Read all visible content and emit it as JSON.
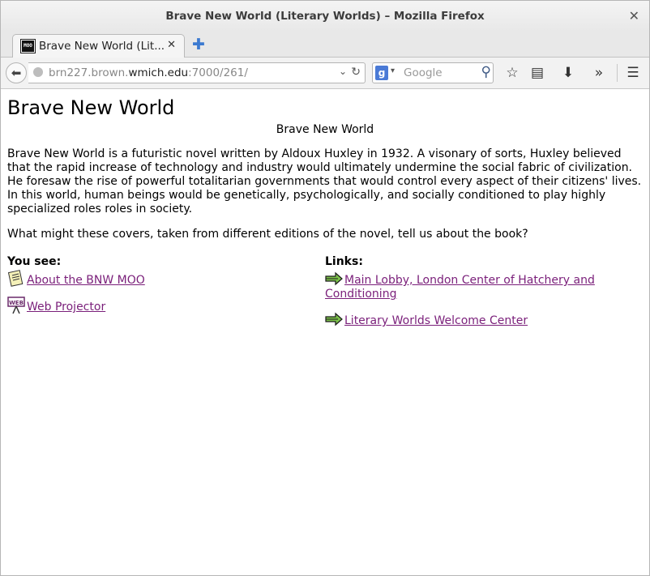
{
  "window": {
    "title": "Brave New World (Literary Worlds) – Mozilla Firefox"
  },
  "tab": {
    "label": "Brave New World (Lit...",
    "favicon": "MOO"
  },
  "nav": {
    "url_prefix": "brn227.brown.",
    "url_host": "wmich.edu",
    "url_suffix": ":7000/261/",
    "search_placeholder": "Google"
  },
  "page": {
    "heading": "Brave New World",
    "caption": "Brave New World",
    "paragraph1": "Brave New World is a futuristic novel written by Aldoux Huxley in 1932. A visonary of sorts, Huxley believed that the rapid increase of technology and industry would ultimately undermine the social fabric of civilization. He foresaw the rise of powerful totalitarian governments that would control every aspect of their citizens' lives. In this world, human beings would be genetically, psychologically, and socially conditioned to play highly specialized roles roles in society.",
    "paragraph2": "What might these covers, taken from different editions of the novel, tell us about the book?",
    "you_see_heading": "You see:",
    "you_see_items": [
      {
        "label": "About the BNW MOO",
        "icon": "note-icon"
      },
      {
        "label": "Web Projector",
        "icon": "web-projector-icon"
      }
    ],
    "links_heading": "Links:",
    "links": [
      {
        "label": "Main Lobby, London Center of Hatchery and Conditioning",
        "icon": "exit-arrow-icon"
      },
      {
        "label": "Literary Worlds Welcome Center",
        "icon": "exit-arrow-icon"
      }
    ]
  },
  "colors": {
    "link": "#7a1f7a",
    "accent": "#3c7ad0"
  }
}
